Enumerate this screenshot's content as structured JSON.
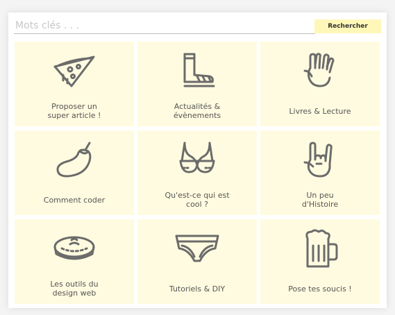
{
  "search": {
    "placeholder": "Mots clés . . .",
    "button_label": "Rechercher"
  },
  "categories": [
    {
      "label": "Proposer un\nsuper article !",
      "icon": "pizza-icon"
    },
    {
      "label": "Actualités &\névènements",
      "icon": "sandal-icon"
    },
    {
      "label": "Livres & Lecture",
      "icon": "vulcan-salute-icon"
    },
    {
      "label": "Comment coder",
      "icon": "eggplant-icon"
    },
    {
      "label": "Qu'est-ce qui est\ncool ?",
      "icon": "bra-icon"
    },
    {
      "label": "Un peu\nd'Histoire",
      "icon": "rock-hand-icon"
    },
    {
      "label": "Les outils du\ndesign web",
      "icon": "pie-icon"
    },
    {
      "label": "Tutoriels & DIY",
      "icon": "underwear-icon"
    },
    {
      "label": "Pose tes soucis !",
      "icon": "beer-mug-icon"
    }
  ],
  "colors": {
    "tile_background": "#fffbe0",
    "button_background": "#fff7b8",
    "icon_stroke": "#6b6b6b",
    "label_text": "#555555"
  }
}
